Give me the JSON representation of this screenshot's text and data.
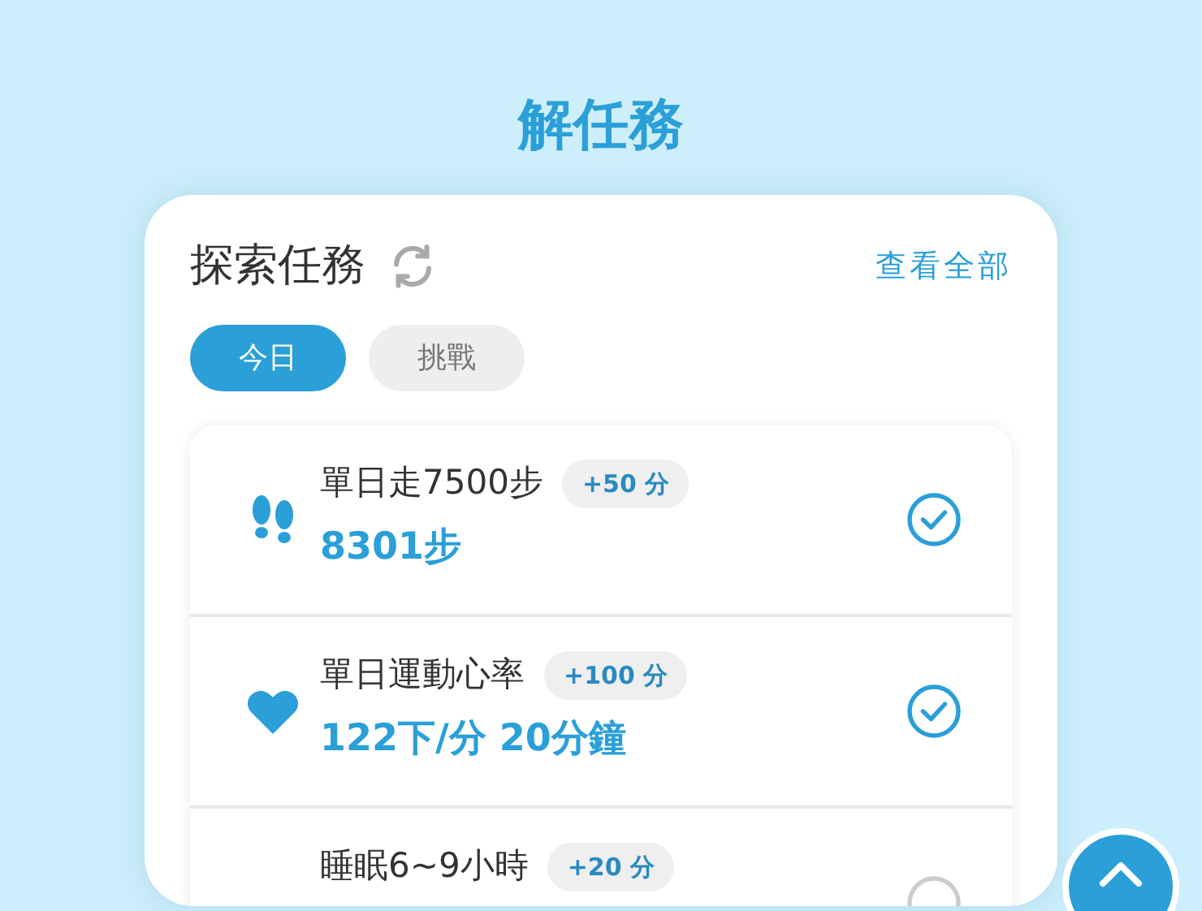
{
  "page_title": "解任務",
  "card": {
    "title": "探索任務",
    "view_all": "查看全部",
    "tabs": [
      {
        "label": "今日",
        "selected": true
      },
      {
        "label": "挑戰",
        "selected": false
      }
    ],
    "tasks": [
      {
        "kind": "steps",
        "name": "單日走7500步",
        "points": "+50 分",
        "progress": "8301步",
        "completed": true
      },
      {
        "kind": "heart",
        "name": "單日運動心率",
        "points": "+100 分",
        "progress": "122下/分 20分鐘",
        "completed": true
      },
      {
        "kind": "sleep",
        "name": "睡眠6~9小時",
        "points": "+20 分",
        "completed": false
      }
    ]
  }
}
